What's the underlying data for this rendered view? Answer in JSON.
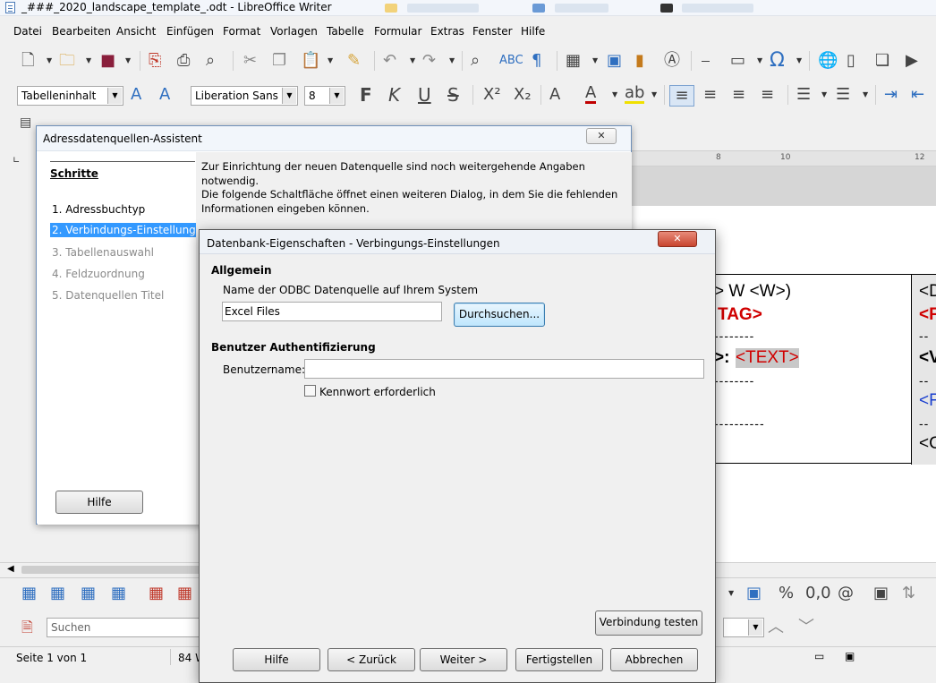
{
  "window": {
    "title": "_###_2020_landscape_template_.odt - LibreOffice Writer"
  },
  "menu": [
    "Datei",
    "Bearbeiten",
    "Ansicht",
    "Einfügen",
    "Format",
    "Vorlagen",
    "Tabelle",
    "Formular",
    "Extras",
    "Fenster",
    "Hilfe"
  ],
  "format_bar": {
    "paragraph_style": "Tabelleninhalt",
    "font_name": "Liberation Sans",
    "font_size": "8"
  },
  "document": {
    "line1": "> W <W>)",
    "line2": "TAG>",
    "line3": ">: ",
    "line3_field": "<TEXT>",
    "col2_line1": "<D",
    "col2_line2": "<F",
    "col2_line4": "<V",
    "col2_line6": "<F",
    "col2_line7": "<C",
    "ruler_8": "8",
    "ruler_10": "10",
    "ruler_12": "12"
  },
  "assistant": {
    "title": "Adressdatenquellen-Assistent",
    "steps_header": "Schritte",
    "steps": [
      {
        "label": "1. Adressbuchtyp"
      },
      {
        "label": "2. Verbindungs-Einstellungen"
      },
      {
        "label": "3. Tabellenauswahl"
      },
      {
        "label": "4. Feldzuordnung"
      },
      {
        "label": "5. Datenquellen Titel"
      }
    ],
    "intro": "Zur Einrichtung der neuen Datenquelle sind noch weitergehende Angaben notwendig.",
    "desc": "Die folgende Schaltfläche öffnet einen weiteren Dialog, in dem Sie die fehlenden Informationen eingeben können.",
    "help_button": "Hilfe"
  },
  "props_dialog": {
    "title": "Datenbank-Eigenschaften - Verbingungs-Einstellungen",
    "general_header": "Allgemein",
    "odbc_label": "Name der ODBC Datenquelle auf Ihrem System",
    "odbc_value": "Excel Files",
    "browse_button": "Durchsuchen...",
    "auth_header": "Benutzer Authentifizierung",
    "username_label": "Benutzername:",
    "username_value": "",
    "password_checkbox": "Kennwort erforderlich",
    "test_button": "Verbindung testen",
    "buttons": {
      "help": "Hilfe",
      "back": "< Zurück",
      "next": "Weiter >",
      "finish": "Fertigstellen",
      "cancel": "Abbrechen"
    }
  },
  "findbar": {
    "search_placeholder": "Suchen"
  },
  "status": {
    "page": "Seite 1 von 1",
    "words": "84 W"
  }
}
